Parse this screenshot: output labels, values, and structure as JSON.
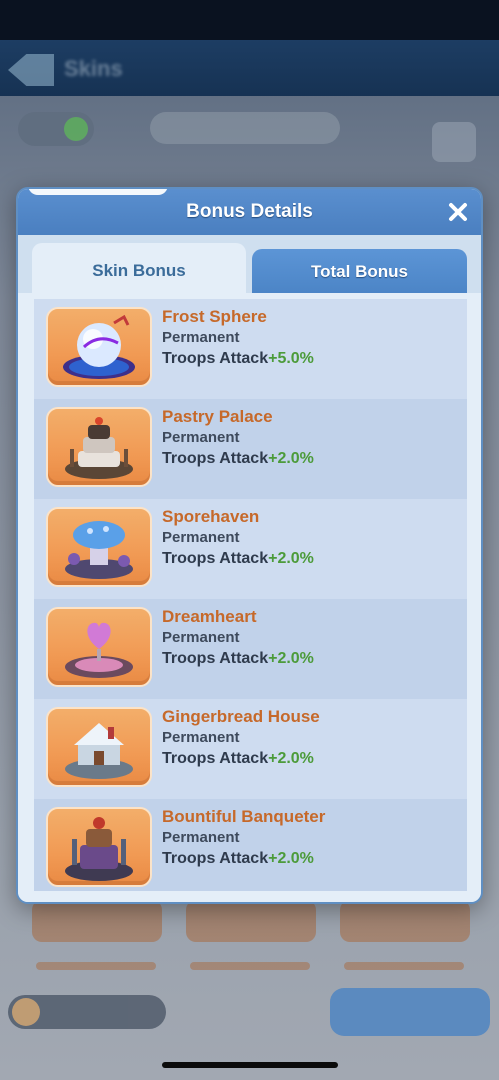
{
  "background": {
    "title": "Skins"
  },
  "modal": {
    "title": "Bonus Details",
    "tabs": [
      {
        "label": "Skin Bonus",
        "active": true
      },
      {
        "label": "Total Bonus",
        "active": false
      }
    ],
    "items": [
      {
        "name": "Frost Sphere",
        "duration": "Permanent",
        "stat": "Troops Attack",
        "value": "+5.0%",
        "icon": "frost-sphere-icon"
      },
      {
        "name": "Pastry Palace",
        "duration": "Permanent",
        "stat": "Troops Attack",
        "value": "+2.0%",
        "icon": "pastry-palace-icon"
      },
      {
        "name": "Sporehaven",
        "duration": "Permanent",
        "stat": "Troops Attack",
        "value": "+2.0%",
        "icon": "sporehaven-icon"
      },
      {
        "name": "Dreamheart",
        "duration": "Permanent",
        "stat": "Troops Attack",
        "value": "+2.0%",
        "icon": "dreamheart-icon"
      },
      {
        "name": "Gingerbread House",
        "duration": "Permanent",
        "stat": "Troops Attack",
        "value": "+2.0%",
        "icon": "gingerbread-house-icon"
      },
      {
        "name": "Bountiful Banqueter",
        "duration": "Permanent",
        "stat": "Troops Attack",
        "value": "+2.0%",
        "icon": "bountiful-banqueter-icon"
      }
    ]
  },
  "colors": {
    "name": "#c6692a",
    "bonus_value": "#4c9b3a",
    "header": "#4a7fc0"
  }
}
